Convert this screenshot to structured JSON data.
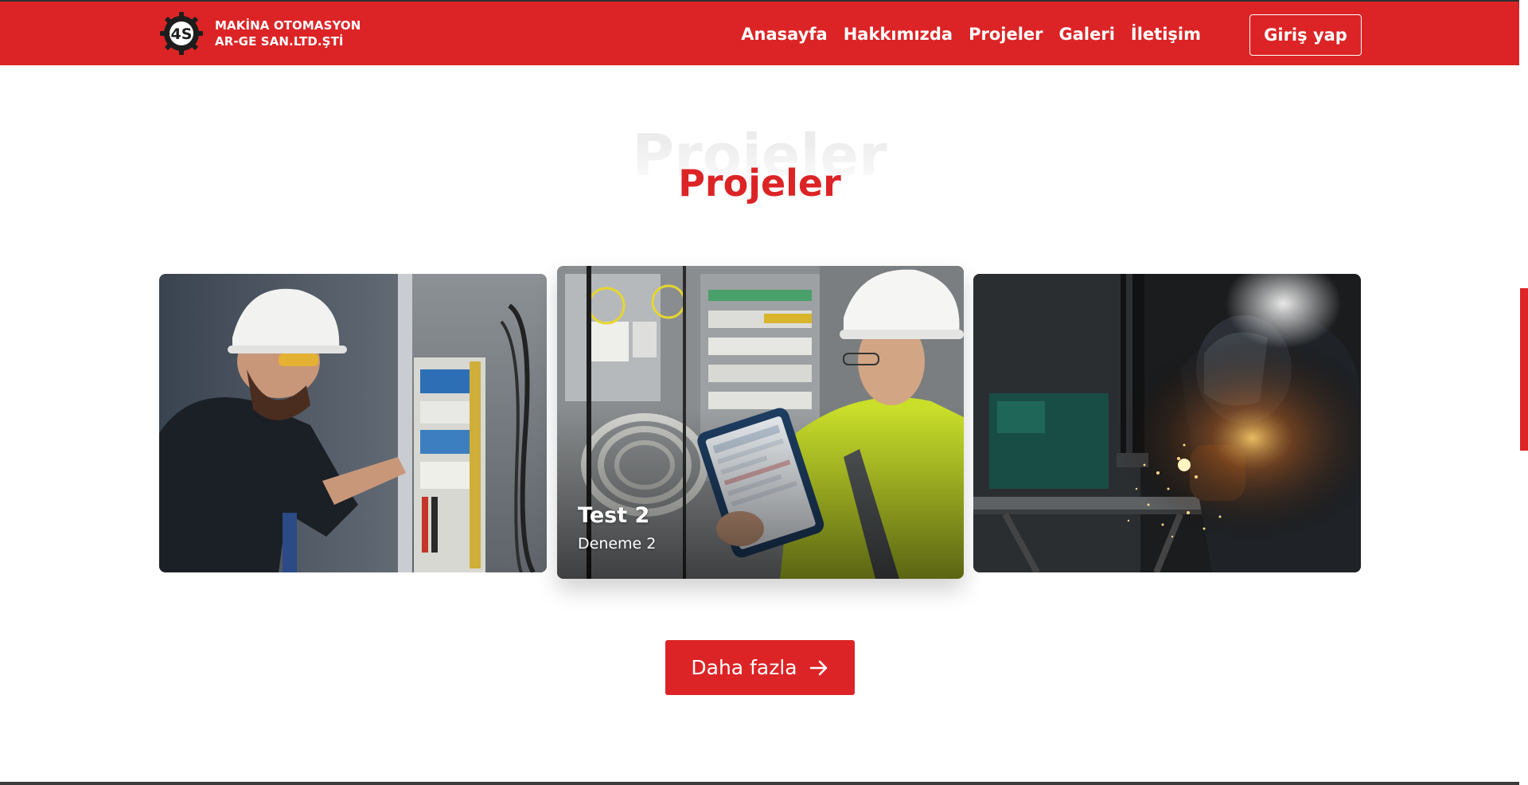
{
  "brand": {
    "line1": "MAKİNA OTOMASYON",
    "line2": "AR-GE SAN.LTD.ŞTİ",
    "logo_text": "4S",
    "logo_icon": "gear-icon"
  },
  "nav": {
    "links": [
      "Anasayfa",
      "Hakkımızda",
      "Projeler",
      "Galeri",
      "İletişim"
    ],
    "login_label": "Giriş yap"
  },
  "section": {
    "title_shadow": "Projeler",
    "title": "Projeler"
  },
  "cards": [
    {
      "image": "electrician-panel-photo"
    },
    {
      "image": "engineer-tablet-panel-photo",
      "title": "Test 2",
      "subtitle": "Deneme 2"
    },
    {
      "image": "welder-sparks-photo"
    }
  ],
  "more_button": {
    "label": "Daha fazla",
    "icon": "arrow-right-icon"
  },
  "colors": {
    "brand_red": "#dc2426",
    "white": "#ffffff"
  }
}
